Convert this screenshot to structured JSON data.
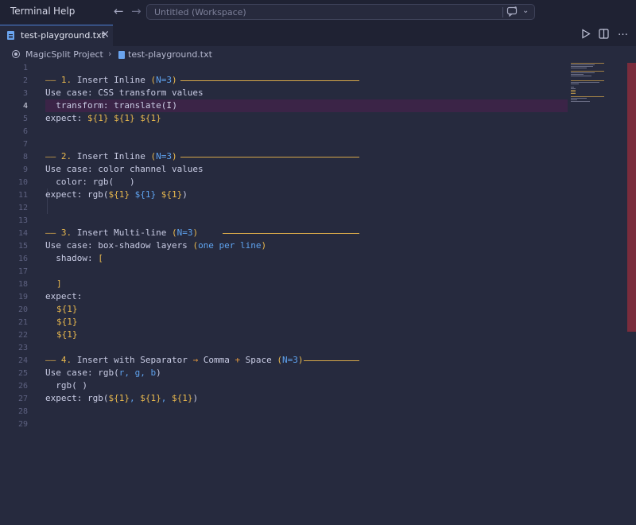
{
  "menu": {
    "terminal": "Terminal",
    "help": "Help"
  },
  "command_center": {
    "placeholder": "Untitled (Workspace)"
  },
  "tab": {
    "label": "test-playground.txt",
    "close": "×"
  },
  "breadcrumb": {
    "project": "MagicSplit Project",
    "file": "test-playground.txt"
  },
  "editor": {
    "active_line": 4,
    "line_numbers": [
      "1",
      "2",
      "3",
      "4",
      "5",
      "6",
      "7",
      "8",
      "9",
      "10",
      "11",
      "12",
      "13",
      "14",
      "15",
      "16",
      "17",
      "18",
      "19",
      "20",
      "21",
      "22",
      "23",
      "24",
      "25",
      "26",
      "27",
      "28",
      "29"
    ],
    "lines": {
      "l2": {
        "dash": "—— ",
        "num": "1.",
        "text": " Insert Inline ",
        "paren_open": "(",
        "n": "N=3",
        "paren_close": ")"
      },
      "l3": {
        "text": "Use case: CSS transform values"
      },
      "l4": {
        "text": "  transform: translate(",
        "cursor": "I",
        "close": ")"
      },
      "l5": {
        "prefix": "expect: ",
        "v1": "${1}",
        "v2": "${1}",
        "v3": "${1}"
      },
      "l8": {
        "dash": "—— ",
        "num": "2.",
        "text": " Insert Inline ",
        "paren_open": "(",
        "n": "N=3",
        "paren_close": ")"
      },
      "l9": {
        "text": "Use case: color channel values"
      },
      "l10": {
        "text": "  color: rgb(   )"
      },
      "l11": {
        "prefix": "expect: rgb(",
        "v1": "${1}",
        "v2": "${1}",
        "v3": "${1}",
        "suffix": ")"
      },
      "l14": {
        "dash": "—— ",
        "num": "3.",
        "text": " Insert Multi-line ",
        "paren_open": "(",
        "n": "N=3",
        "paren_close": ")"
      },
      "l15": {
        "prefix": "Use case: box-shadow layers ",
        "paren_open": "(",
        "blue": "one per line",
        "paren_close": ")"
      },
      "l16": {
        "text": "  shadow: ",
        "bracket": "["
      },
      "l18": {
        "bracket": "]"
      },
      "l19": {
        "text": "expect:"
      },
      "l20": {
        "v": "${1}"
      },
      "l21": {
        "v": "${1}"
      },
      "l22": {
        "v": "${1}"
      },
      "l24": {
        "dash": "—— ",
        "num": "4.",
        "text": " Insert with Separator ",
        "arrow": "→",
        "text2": " Comma ",
        "plus": "+",
        "text3": " Space ",
        "paren_open": "(",
        "n": "N=3",
        "paren_close": ")"
      },
      "l25": {
        "prefix": "Use case: rgb(",
        "r": "r",
        "c1": ", ",
        "g": "g",
        "c2": ", ",
        "b": "b",
        "suffix": ")"
      },
      "l26": {
        "text": "  rgb( )"
      },
      "l27": {
        "prefix": "expect: rgb(",
        "v1": "${1}",
        "s1": ", ",
        "v2": "${1}",
        "s2": ", ",
        "v3": "${1}",
        "suffix": ")"
      }
    }
  },
  "icons": {
    "back": "back-arrow-icon",
    "forward": "forward-arrow-icon",
    "copilot": "copilot-chat-icon",
    "run": "run-icon",
    "split": "split-editor-icon",
    "more": "more-actions-icon"
  },
  "colors": {
    "accent": "#4d7fd6",
    "yellow": "#e8b84e",
    "blue": "#5fa3ef",
    "scrollbar": "#7a2c3c",
    "active_line": "#3b2447"
  }
}
